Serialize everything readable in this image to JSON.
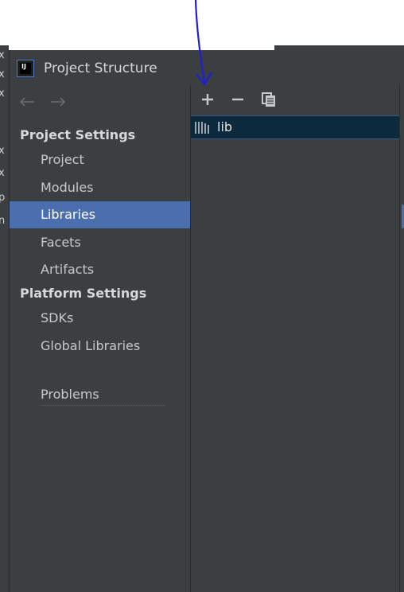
{
  "window": {
    "title": "Project Structure",
    "app_icon_text": "IJ"
  },
  "nav": {
    "back_icon": "arrow-left-icon",
    "forward_icon": "arrow-right-icon"
  },
  "sidebar": {
    "sections": [
      {
        "label": "Project Settings",
        "items": [
          {
            "label": "Project",
            "selected": false
          },
          {
            "label": "Modules",
            "selected": false
          },
          {
            "label": "Libraries",
            "selected": true
          },
          {
            "label": "Facets",
            "selected": false
          },
          {
            "label": "Artifacts",
            "selected": false
          }
        ]
      },
      {
        "label": "Platform Settings",
        "items": [
          {
            "label": "SDKs",
            "selected": false
          },
          {
            "label": "Global Libraries",
            "selected": false
          }
        ]
      }
    ],
    "problems_label": "Problems"
  },
  "toolbar": {
    "add_icon": "plus-icon",
    "remove_icon": "minus-icon",
    "copy_icon": "copy-icon"
  },
  "libraries": [
    {
      "name": "lib",
      "icon": "library-icon",
      "selected": true
    }
  ],
  "background_edge_glyphs": [
    "x",
    "x",
    "x",
    "x",
    "x",
    "p",
    "n"
  ],
  "colors": {
    "selection": "#4b6eaf",
    "list_selection": "#0d293e",
    "annotation_arrow": "#1f1fd6",
    "panel": "#3c3f41"
  }
}
